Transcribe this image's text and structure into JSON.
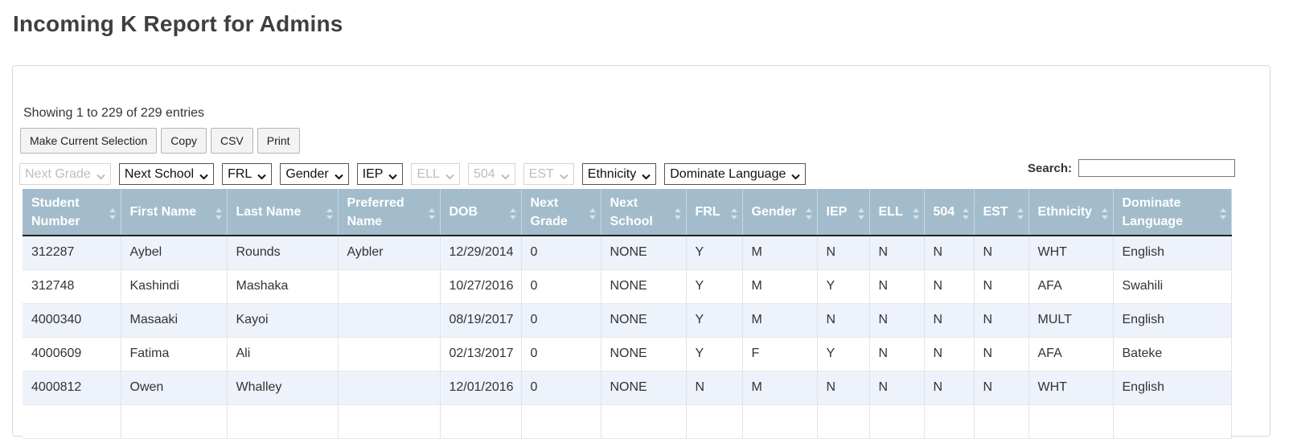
{
  "page": {
    "title": "Incoming K Report for Admins"
  },
  "table_info": "Showing 1 to 229 of 229 entries",
  "buttons": [
    "Make Current Selection",
    "Copy",
    "CSV",
    "Print"
  ],
  "filters": [
    {
      "label": "Next Grade",
      "disabled": true
    },
    {
      "label": "Next School",
      "disabled": false
    },
    {
      "label": "FRL",
      "disabled": false
    },
    {
      "label": "Gender",
      "disabled": false
    },
    {
      "label": "IEP",
      "disabled": false
    },
    {
      "label": "ELL",
      "disabled": true
    },
    {
      "label": "504",
      "disabled": true
    },
    {
      "label": "EST",
      "disabled": true
    },
    {
      "label": "Ethnicity",
      "disabled": false
    },
    {
      "label": "Dominate Language",
      "disabled": false
    }
  ],
  "search": {
    "label": "Search:",
    "value": ""
  },
  "columns": [
    "Student Number",
    "First Name",
    "Last Name",
    "Preferred Name",
    "DOB",
    "Next Grade",
    "Next School",
    "FRL",
    "Gender",
    "IEP",
    "ELL",
    "504",
    "EST",
    "Ethnicity",
    "Dominate Language"
  ],
  "rows": [
    [
      "312287",
      "Aybel",
      "Rounds",
      "Aybler",
      "12/29/2014",
      "0",
      "NONE",
      "Y",
      "M",
      "N",
      "N",
      "N",
      "N",
      "WHT",
      "English"
    ],
    [
      "312748",
      "Kashindi",
      "Mashaka",
      "",
      "10/27/2016",
      "0",
      "NONE",
      "Y",
      "M",
      "Y",
      "N",
      "N",
      "N",
      "AFA",
      "Swahili"
    ],
    [
      "4000340",
      "Masaaki",
      "Kayoi",
      "",
      "08/19/2017",
      "0",
      "NONE",
      "Y",
      "M",
      "N",
      "N",
      "N",
      "N",
      "MULT",
      "English"
    ],
    [
      "4000609",
      "Fatima",
      "Ali",
      "",
      "02/13/2017",
      "0",
      "NONE",
      "Y",
      "F",
      "Y",
      "N",
      "N",
      "N",
      "AFA",
      "Bateke"
    ],
    [
      "4000812",
      "Owen",
      "Whalley",
      "",
      "12/01/2016",
      "0",
      "NONE",
      "N",
      "M",
      "N",
      "N",
      "N",
      "N",
      "WHT",
      "English"
    ],
    [
      "",
      "",
      "",
      "",
      "",
      "",
      "",
      "",
      "",
      "",
      "",
      "",
      "",
      "",
      ""
    ]
  ],
  "colors": {
    "header_bg": "#a3bccb",
    "row_alt_bg": "#edf2fb"
  }
}
